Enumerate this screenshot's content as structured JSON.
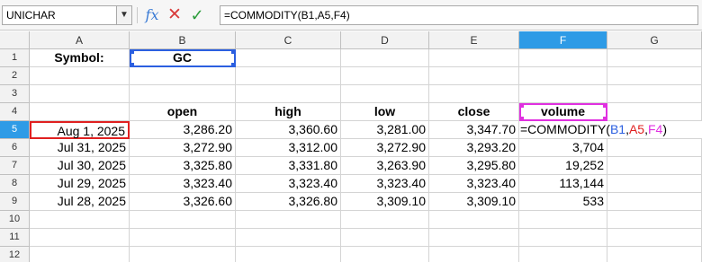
{
  "formula_bar": {
    "name_box": "UNICHAR",
    "formula": "=COMMODITY(B1,A5,F4)"
  },
  "columns": [
    "A",
    "B",
    "C",
    "D",
    "E",
    "F",
    "G"
  ],
  "rows": [
    "1",
    "2",
    "3",
    "4",
    "5",
    "6",
    "7",
    "8",
    "9",
    "10",
    "11",
    "12"
  ],
  "cells": {
    "A1": "Symbol:",
    "B1": "GC",
    "B4": "open",
    "C4": "high",
    "D4": "low",
    "E4": "close",
    "F4": "volume",
    "A5": "Aug 1, 2025",
    "B5": "3,286.20",
    "C5": "3,360.60",
    "D5": "3,281.00",
    "E5": "3,347.70",
    "A6": "Jul 31, 2025",
    "B6": "3,272.90",
    "C6": "3,312.00",
    "D6": "3,272.90",
    "E6": "3,293.20",
    "F6": "3,704",
    "A7": "Jul 30, 2025",
    "B7": "3,325.80",
    "C7": "3,331.80",
    "D7": "3,263.90",
    "E7": "3,295.80",
    "F7": "19,252",
    "A8": "Jul 29, 2025",
    "B8": "3,323.40",
    "C8": "3,323.40",
    "D8": "3,323.40",
    "E8": "3,323.40",
    "F8": "113,144",
    "A9": "Jul 28, 2025",
    "B9": "3,326.60",
    "C9": "3,326.80",
    "D9": "3,309.10",
    "E9": "3,309.10",
    "F9": "533"
  },
  "editing_cell": {
    "ref": "F5",
    "prefix": "=COMMODITY(",
    "arg1": "B1",
    "sep1": ",",
    "arg2": "A5",
    "sep2": ",",
    "arg3": "F4",
    "suffix": ")"
  },
  "active_column": "F",
  "active_row": "5",
  "colors": {
    "header_active": "#2e9be6",
    "ref_b1": "#2b5fe0",
    "ref_a5": "#e02020",
    "ref_f4": "#e030e0"
  }
}
